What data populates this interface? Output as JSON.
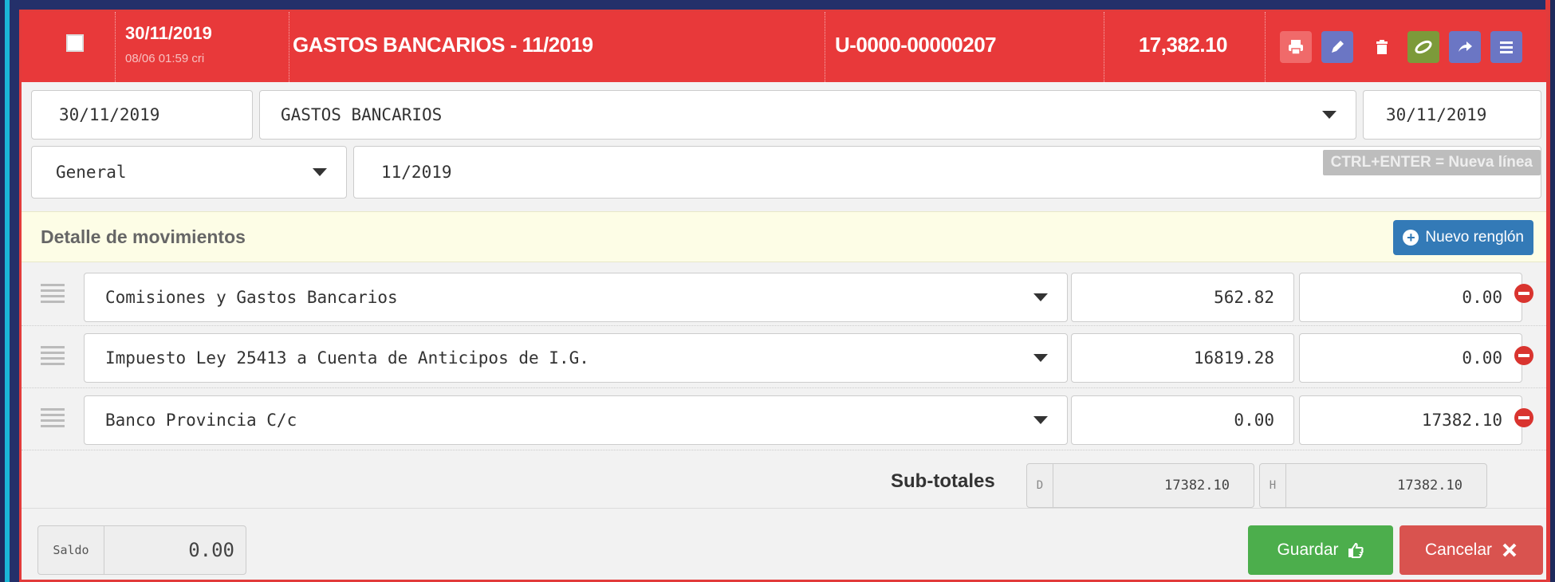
{
  "header": {
    "date": "30/11/2019",
    "sub_date": "08/06 01:59 cri",
    "title": "GASTOS BANCARIOS - 11/2019",
    "code": "U-0000-00000207",
    "amount": "17,382.10",
    "icons": [
      "print-icon",
      "edit-icon",
      "trash-icon",
      "attach-icon",
      "share-icon",
      "menu-icon"
    ],
    "colors": {
      "header_bg": "#e8393a"
    }
  },
  "form": {
    "date": "30/11/2019",
    "concept": "GASTOS BANCARIOS",
    "date2": "30/11/2019",
    "type": "General",
    "period": "11/2019",
    "hint": "CTRL+ENTER = Nueva línea"
  },
  "detalle": {
    "title": "Detalle de movimientos",
    "new_row_label": "Nuevo renglón"
  },
  "rows": [
    {
      "account": "Comisiones y Gastos Bancarios",
      "debit": "562.82",
      "credit": "0.00"
    },
    {
      "account": "Impuesto Ley 25413 a Cuenta de Anticipos de I.G.",
      "debit": "16819.28",
      "credit": "0.00"
    },
    {
      "account": "Banco Provincia C/c",
      "debit": "0.00",
      "credit": "17382.10"
    }
  ],
  "subtotals": {
    "label": "Sub-totales",
    "debit_prefix": "D",
    "debit": "17382.10",
    "credit_prefix": "H",
    "credit": "17382.10"
  },
  "saldo": {
    "label": "Saldo",
    "value": "0.00"
  },
  "buttons": {
    "save": "Guardar",
    "cancel": "Cancelar"
  }
}
